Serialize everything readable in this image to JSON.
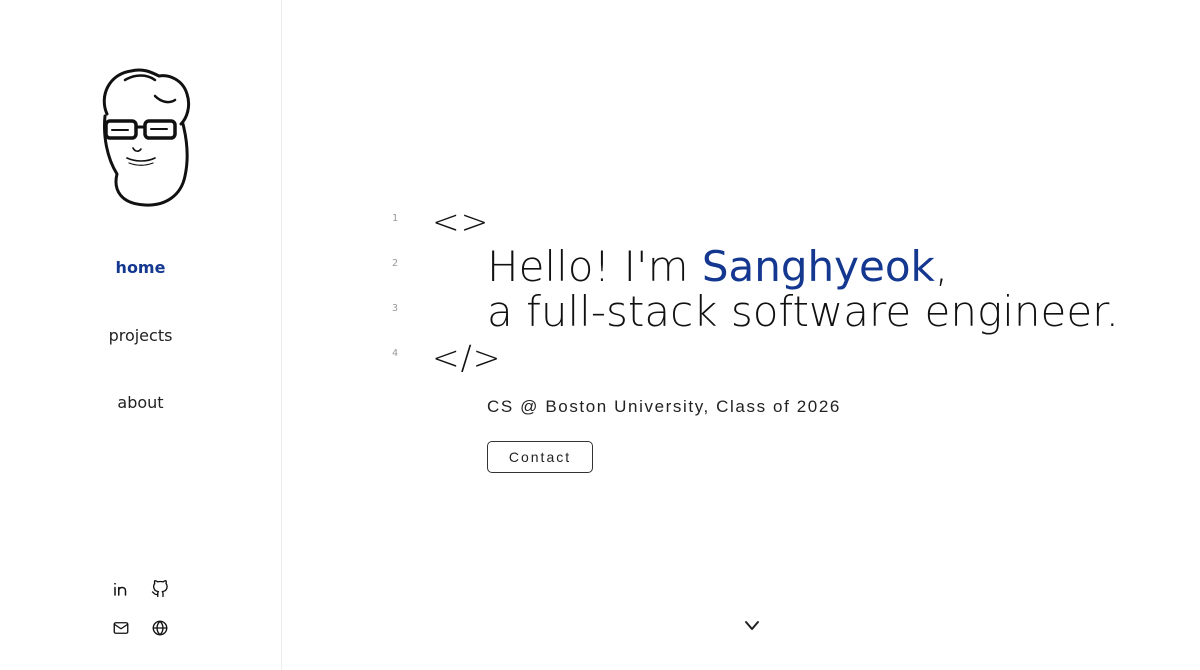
{
  "sidebar": {
    "nav": [
      {
        "label": "home",
        "active": true
      },
      {
        "label": "projects",
        "active": false
      },
      {
        "label": "about",
        "active": false
      }
    ],
    "social_icons": [
      "linkedin-icon",
      "github-icon",
      "mail-icon",
      "globe-icon"
    ]
  },
  "main": {
    "line_numbers": [
      "1",
      "2",
      "3",
      "4"
    ],
    "open_tag": "<>",
    "close_tag": "</>",
    "greeting_prefix": "Hello! I'm ",
    "name": "Sanghyeok",
    "greeting_suffix": ",",
    "headline_line2": "a full-stack software engineer.",
    "subtitle": "CS @ Boston University, Class of 2026",
    "contact_label": "Contact"
  },
  "colors": {
    "accent": "#14378f",
    "text": "#111111",
    "line_number": "#9a9a9a",
    "divider": "#ececec"
  }
}
